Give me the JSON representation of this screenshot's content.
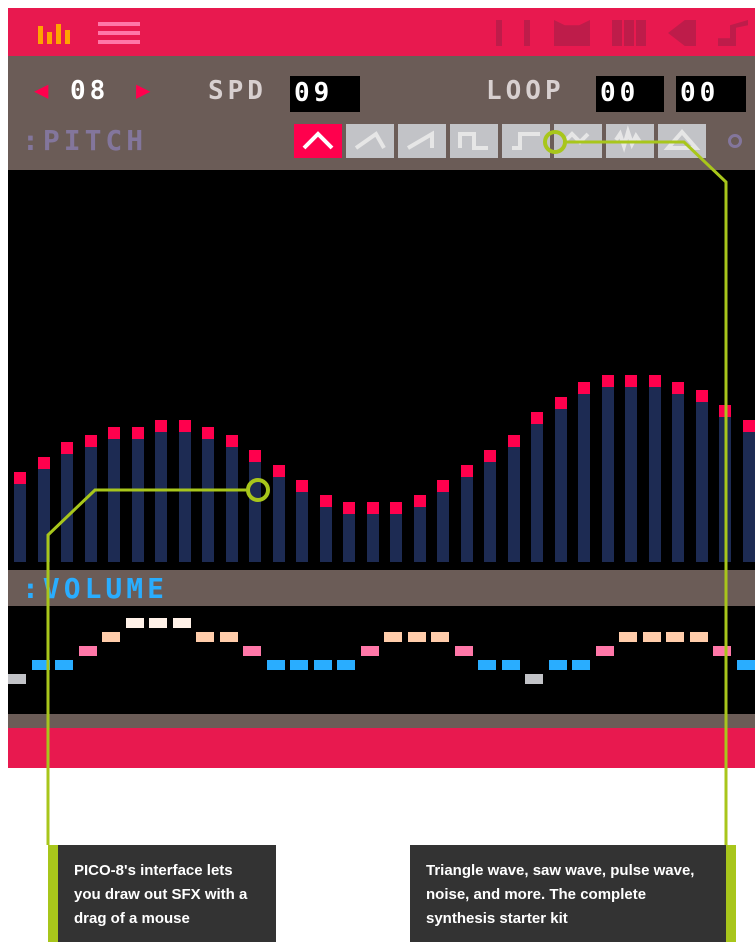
{
  "colors": {
    "accent": "#e8194f",
    "panel": "#6b5c57",
    "screen": "#000000",
    "bar": "#1d2b53",
    "bar_tip": "#ff004d",
    "wave_selected": "#ff004d",
    "wave_normal": "#c2c3c7",
    "volume_label": "#29adff",
    "pitch_label": "#83769c",
    "callout_line": "#a8c61b",
    "caption_bg": "#333333"
  },
  "toolbar": {
    "left_icons": [
      "bars-icon",
      "grid-icon"
    ],
    "right_icons": [
      "code-icon",
      "sprite-icon",
      "map-icon",
      "sfx-icon",
      "music-icon"
    ]
  },
  "sfx_controls": {
    "prev_label": "◀",
    "sfx_index": "08",
    "next_label": "▶",
    "speed_label": "SPD",
    "speed_value": "09",
    "loop_label": "LOOP",
    "loop_start": "00",
    "loop_end": "00"
  },
  "pitch_section": {
    "label": ":PITCH",
    "waveforms": [
      "triangle-wave",
      "tilted-saw-wave",
      "saw-wave",
      "square-wave",
      "pulse-wave",
      "organ-wave",
      "noise-wave",
      "phaser-wave"
    ],
    "selected_index": 0
  },
  "pitch_values": [
    6,
    7,
    8,
    8.5,
    9,
    9,
    9.5,
    9.5,
    9,
    8.5,
    7.5,
    6.5,
    5.5,
    4.5,
    4,
    4,
    4,
    4.5,
    5.5,
    6.5,
    7.5,
    8.5,
    10,
    11,
    12,
    12.5,
    12.5,
    12.5,
    12,
    11.5,
    10.5,
    9.5,
    8.5,
    8
  ],
  "volume_section": {
    "label": ":VOLUME",
    "levels": [
      2,
      3,
      3,
      4,
      5,
      6,
      6,
      6,
      5,
      5,
      4,
      3,
      3,
      3,
      3,
      4,
      5,
      5,
      5,
      4,
      3,
      3,
      2,
      3,
      3,
      4,
      5,
      5,
      5,
      5,
      4,
      3
    ]
  },
  "callouts": {
    "left": "PICO-8's interface lets you draw out SFX with a drag of a mouse",
    "right": "Triangle wave, saw wave, pulse wave, noise, and more. The complete synthesis starter kit"
  }
}
